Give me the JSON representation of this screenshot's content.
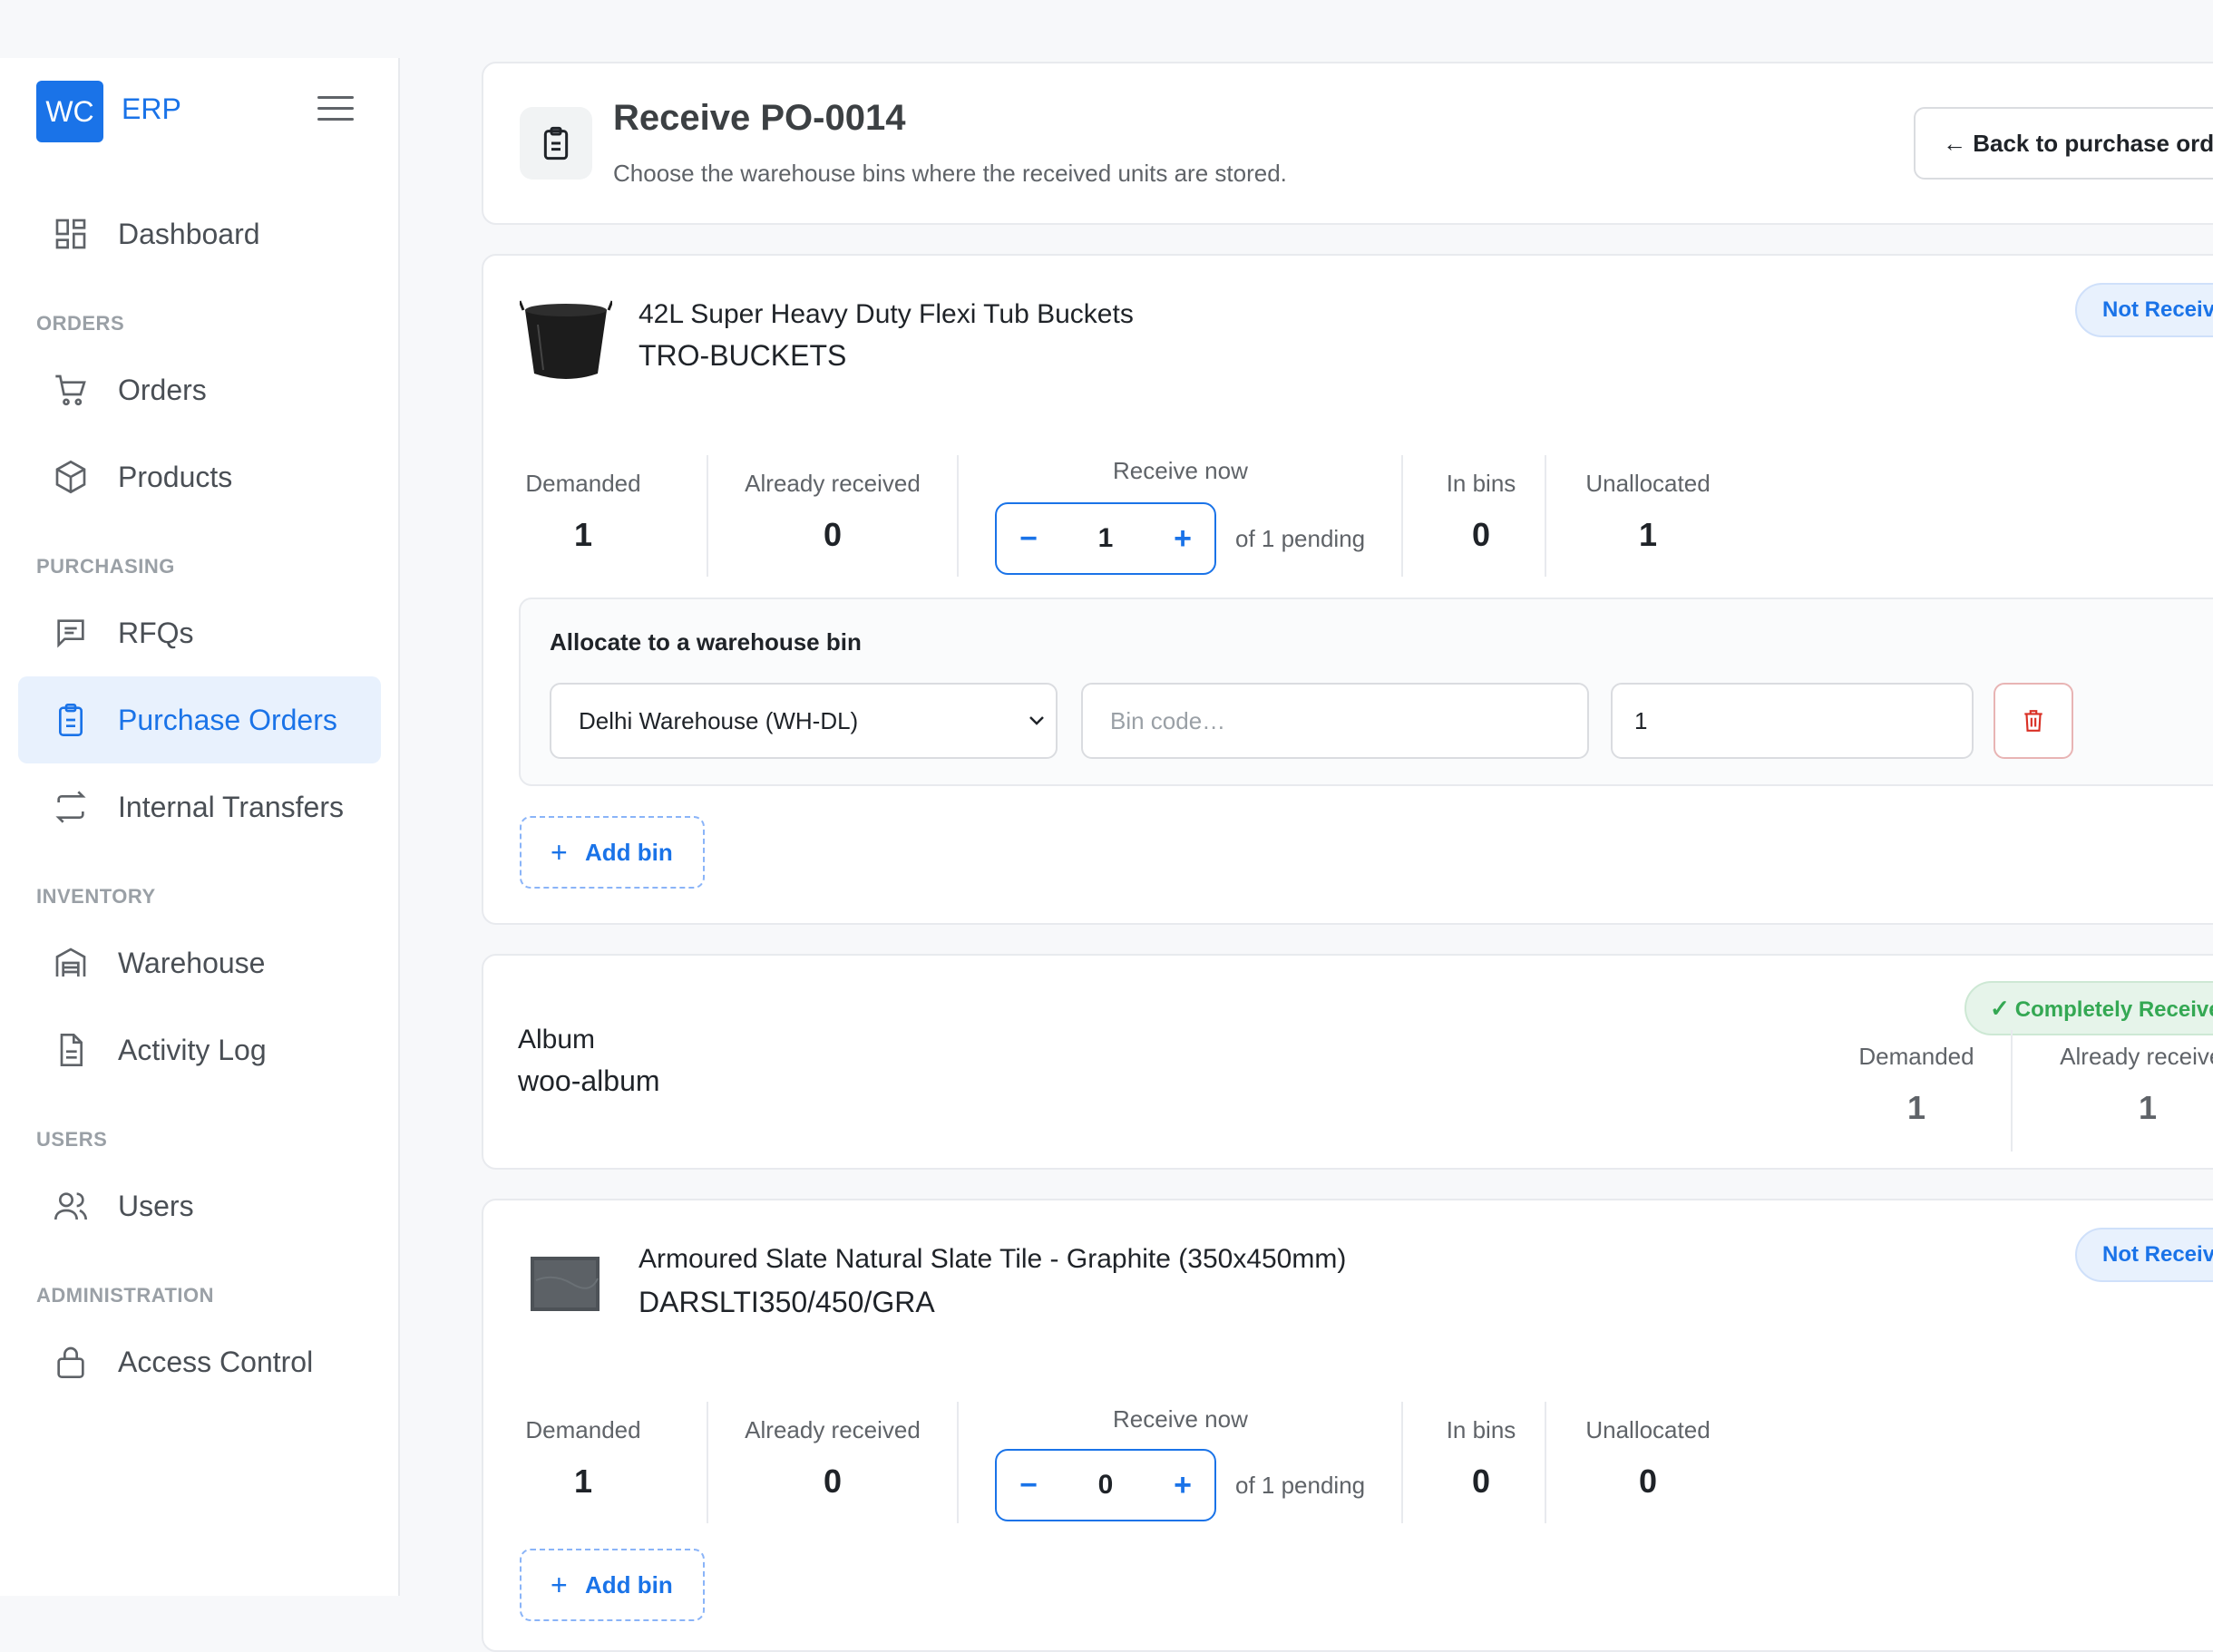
{
  "brand": {
    "logo": "WC",
    "name": "ERP"
  },
  "nav": {
    "dashboard": "Dashboard",
    "sections": {
      "orders": "ORDERS",
      "purchasing": "PURCHASING",
      "inventory": "INVENTORY",
      "users": "USERS",
      "administration": "ADMINISTRATION"
    },
    "orders": "Orders",
    "products": "Products",
    "rfqs": "RFQs",
    "purchase_orders": "Purchase Orders",
    "internal_transfers": "Internal Transfers",
    "warehouse": "Warehouse",
    "activity_log": "Activity Log",
    "users": "Users",
    "access_control": "Access Control",
    "active_item": "Purchase Orders"
  },
  "header": {
    "title": "Receive PO-0014",
    "subtitle": "Choose the warehouse bins where the received units are stored.",
    "back_label": "← Back to purchase orders"
  },
  "labels": {
    "demanded": "Demanded",
    "already_received": "Already received",
    "receive_now": "Receive now",
    "in_bins": "In bins",
    "unallocated": "Unallocated",
    "add_bin": "Add bin",
    "allocate_title": "Allocate to a warehouse bin"
  },
  "items": [
    {
      "name": "42L Super Heavy Duty Flexi Tub Buckets",
      "sku": "TRO-BUCKETS",
      "status": "Not Received",
      "demanded": "1",
      "already_received": "0",
      "receive_now": "1",
      "pending": "of 1 pending",
      "in_bins": "0",
      "unallocated": "1",
      "allocation": {
        "warehouse": "Delhi Warehouse (WH-DL)",
        "bin_placeholder": "Bin code…",
        "qty": "1"
      }
    },
    {
      "name": "Album",
      "sku": "woo-album",
      "status": "Completely Received",
      "demanded": "1",
      "already_received": "1"
    },
    {
      "name": "Armoured Slate Natural Slate Tile - Graphite (350x450mm)",
      "sku": "DARSLTI350/450/GRA",
      "status": "Not Received",
      "demanded": "1",
      "already_received": "0",
      "receive_now": "0",
      "pending": "of 1 pending",
      "in_bins": "0",
      "unallocated": "0"
    }
  ],
  "colors": {
    "accent": "#1a73e8",
    "success": "#34a853",
    "danger": "#d93025"
  }
}
